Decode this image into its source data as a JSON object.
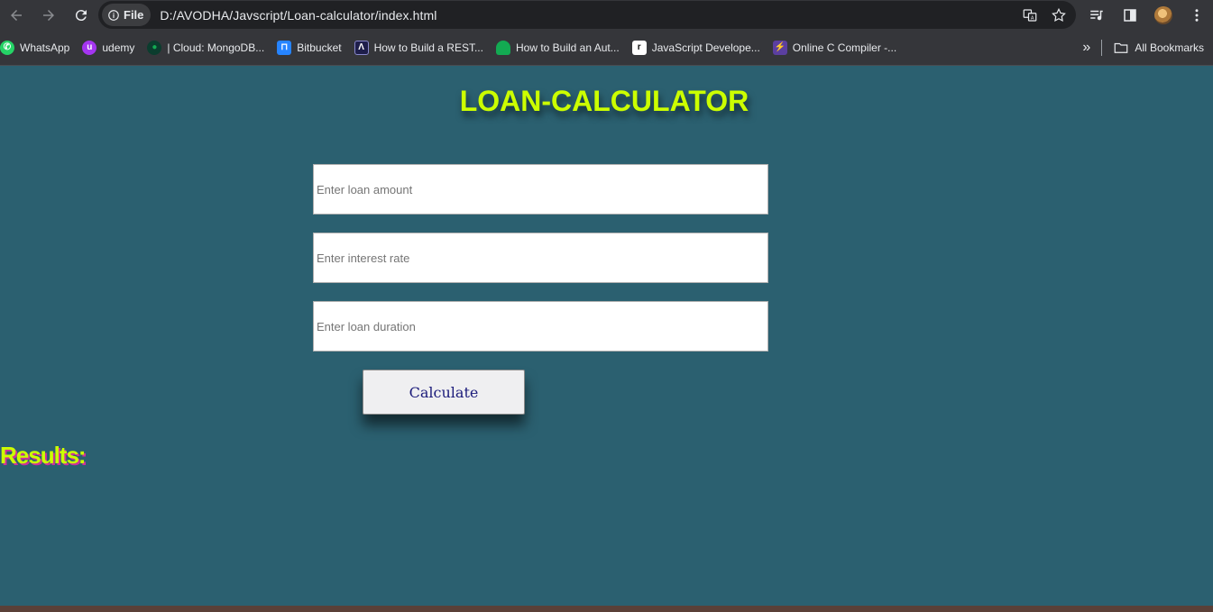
{
  "browser": {
    "site_chip": "File",
    "url": "D:/AVODHA/Javscript/Loan-calculator/index.html",
    "bookmarks": [
      {
        "label": "WhatsApp",
        "icon": "whatsapp-icon",
        "color": "#25d366"
      },
      {
        "label": "udemy",
        "icon": "udemy-icon",
        "color": "#a435f0"
      },
      {
        "label": "| Cloud: MongoDB...",
        "icon": "mongodb-icon",
        "color": "#0b3d2e"
      },
      {
        "label": "Bitbucket",
        "icon": "bitbucket-icon",
        "color": "#2684ff"
      },
      {
        "label": "How to Build a REST...",
        "icon": "rest-icon",
        "color": "#1e1e4a"
      },
      {
        "label": "How to Build an Aut...",
        "icon": "mongodb-leaf-icon",
        "color": "#13aa52"
      },
      {
        "label": "JavaScript Develope...",
        "icon": "js-dev-icon",
        "color": "#111111"
      },
      {
        "label": "Online C Compiler -...",
        "icon": "compiler-icon",
        "color": "#5b3fa0"
      }
    ],
    "all_bookmarks": "All Bookmarks"
  },
  "page": {
    "title": "LOAN-CALCULATOR",
    "amount_placeholder": "Enter loan amount",
    "rate_placeholder": "Enter interest rate",
    "duration_placeholder": "Enter loan duration",
    "calculate_label": "Calculate",
    "results_label": "Results:"
  },
  "colors": {
    "background": "#2b6070",
    "title": "#ccff00",
    "results_shadow": "#d0309a"
  }
}
